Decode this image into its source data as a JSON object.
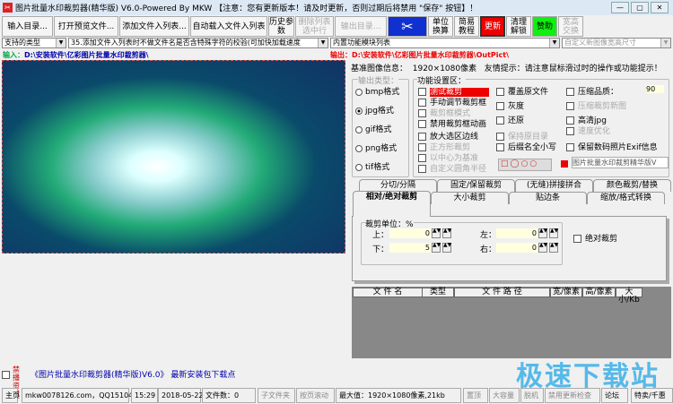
{
  "window": {
    "title": "图片批量水印裁剪器(精华版) V6.0-Powered By MKW 【注意：您有更新版本！请及时更新，否则过期后将禁用 \"保存\" 按钮】！",
    "minimize": "—",
    "maximize": "▢",
    "close": "✕"
  },
  "toolbar": {
    "input_dir": "输入目录...",
    "open_preview": "打开预览文件...",
    "add_files": "添加文件入列表...",
    "auto_load": "自动载入文件入列表",
    "history": "历史参数",
    "delete_selected": "删除列表选中行",
    "output_dir": "输出目录...",
    "unit_convert": "单位换算",
    "tutorial": "简易教程",
    "update": "更新",
    "clear_unlock": "清理解锁",
    "donate": "赞助",
    "wh_swap": "宽高交换"
  },
  "combos": {
    "types": "支持的类型",
    "tip": "35.添加文件入列表时不做文件名是否含特殊字符的校验(可加快加载速度",
    "modules": "内置功能模块列表",
    "custom_size": "自定义新图像宽高尺寸"
  },
  "paths": {
    "input_label": "输入：",
    "input_path": "D:\\安装软件\\亿彩图片批量水印裁剪器\\",
    "output_label": "输出：",
    "output_path": "D:\\安装软件\\亿彩图片批量水印裁剪器\\OutPict\\"
  },
  "info": {
    "base_label": "基准图像信息：",
    "base_value": "1920×1080像素",
    "hint": "友情提示：请注意鼠标滑过时的操作或功能提示！"
  },
  "output_type": {
    "title": "输出类型：",
    "options": [
      "bmp格式",
      "jpg格式",
      "gif格式",
      "png格式",
      "tif格式"
    ],
    "selected": "jpg格式"
  },
  "features": {
    "title": "功能设置区：",
    "col1": [
      "测试裁剪",
      "手动调节裁剪框",
      "裁剪框模式",
      "禁用裁剪框动画",
      "放大选区边线",
      "正方形裁剪",
      "以中心为基准",
      "自定义圆角半径"
    ],
    "col2": [
      "覆盖原文件",
      "灰度",
      "还原",
      "保持原目录",
      "后缀名全小写"
    ],
    "col3": [
      "压缩品质：",
      "压缩裁剪新图",
      "高清jpg",
      "速度优化",
      "保留数码照片Exif信息"
    ],
    "quality": "90",
    "watermark_text": "图片批量水印裁剪精华版V"
  },
  "tabs": {
    "row1": [
      "分切/分隔",
      "固定/保留裁剪",
      "(无缝)拼接拼合",
      "颜色裁剪/替换"
    ],
    "row2": [
      "相对/绝对裁剪",
      "大小裁剪",
      "贴边条",
      "缩放/格式转换"
    ],
    "active": "相对/绝对裁剪"
  },
  "crop": {
    "unit_label": "裁剪单位：%",
    "top_label": "上：",
    "top": "0",
    "bottom_label": "下：",
    "bottom": "5",
    "left_label": "左：",
    "left": "0",
    "right_label": "右：",
    "right": "0",
    "absolute": "绝对裁剪"
  },
  "file_table": {
    "columns": [
      "文 件 名",
      "类型",
      "文 件 路 径",
      "宽/像素",
      "高/像素",
      "大小/Kb"
    ]
  },
  "news": {
    "label": "禁播资讯",
    "link": "《图片批量水印裁剪器(精华版)V6.0》 最新安装包下载点"
  },
  "status": {
    "home": "主页",
    "contact": "mkw0078126.com，QQ15104946",
    "time": "15:29",
    "date": "2018-05-22",
    "file_count": "文件数：0",
    "subfolder": "子文件夹",
    "page_scroll": "按页滚动",
    "max_value": "最大值：1920×1080像素,21kb",
    "top": "置顶",
    "large": "大容量",
    "offline": "脱机",
    "disable_update": "禁用更新检查",
    "forum": "论坛",
    "sale": "特卖/千惠"
  },
  "watermark": "极速下载站"
}
